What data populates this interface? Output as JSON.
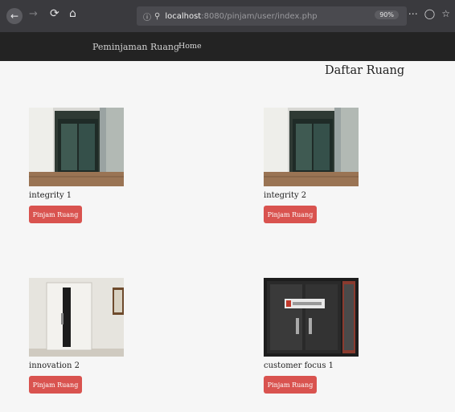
{
  "browser": {
    "back_icon": "back-arrow-icon",
    "forward_icon": "forward-arrow-icon",
    "reload_icon": "reload-icon",
    "home_icon": "home-icon",
    "url_host": "localhost",
    "url_path": ":8080/pinjam/user/index.php",
    "zoom": "90%",
    "more_icon": "ellipsis-icon",
    "pocket_icon": "pocket-icon",
    "bookmark_icon": "star-icon"
  },
  "navbar": {
    "brand": "Peminjaman Ruang",
    "home": "Home"
  },
  "page": {
    "title": "Daftar Ruang"
  },
  "rooms": [
    {
      "name": "integrity 1",
      "button": "Pinjam Ruang",
      "photo": "elevator-lobby-glass-door"
    },
    {
      "name": "integrity 2",
      "button": "Pinjam Ruang",
      "photo": "elevator-lobby-glass-door"
    },
    {
      "name": "innovation 2",
      "button": "Pinjam Ruang",
      "photo": "white-room-door"
    },
    {
      "name": "customer focus 1",
      "button": "Pinjam Ruang",
      "photo": "glass-door-with-sign"
    }
  ],
  "colors": {
    "button": "#d9534f",
    "navbar": "#232323",
    "background": "#f6f6f6"
  }
}
